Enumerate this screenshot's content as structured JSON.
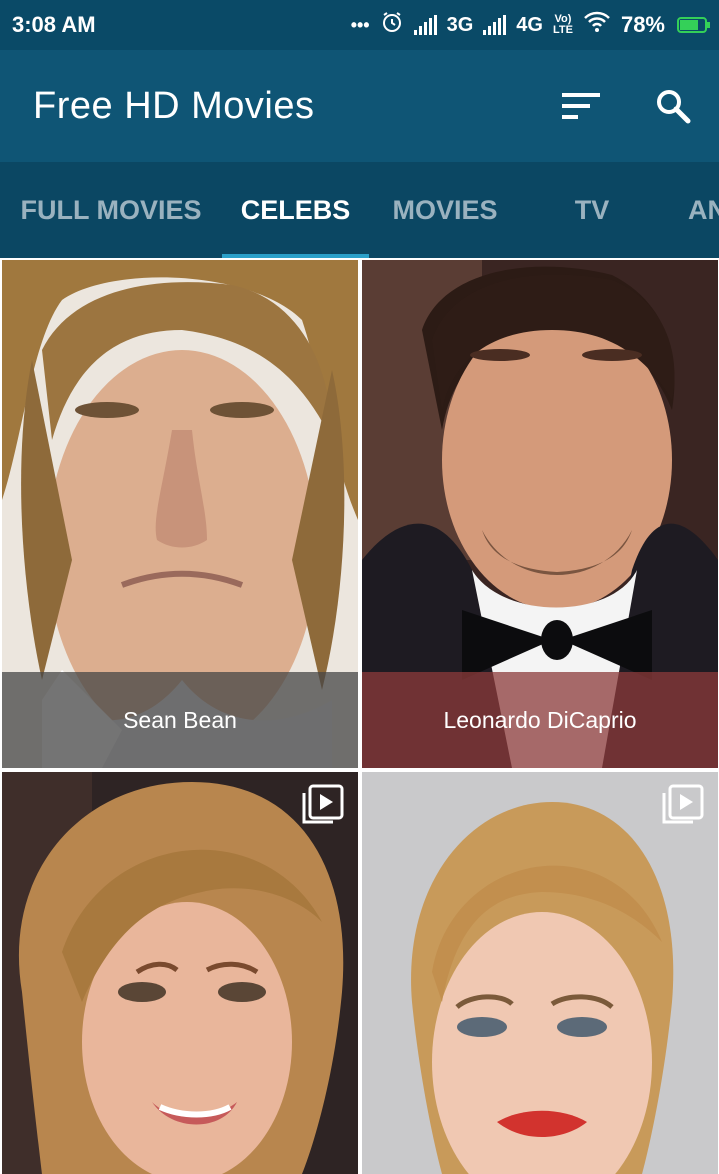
{
  "status_bar": {
    "time": "3:08 AM",
    "dots": "•••",
    "alarm_icon": "alarm-icon",
    "net1": "3G",
    "net2": "4G",
    "volte": "VoLTE",
    "battery": "78%"
  },
  "app_bar": {
    "title": "Free HD Movies",
    "sort_icon": "sort-icon",
    "search_icon": "search-icon"
  },
  "tabs": [
    {
      "label": "FULL MOVIES",
      "active": false
    },
    {
      "label": "CELEBS",
      "active": true
    },
    {
      "label": "MOVIES",
      "active": false
    },
    {
      "label": "TV",
      "active": false
    },
    {
      "label": "AN",
      "active": false
    }
  ],
  "celebs": [
    {
      "name": "Sean Bean",
      "caption_color": "#4a4a4a"
    },
    {
      "name": "Leonardo DiCaprio",
      "caption_color": "#8c3b3b"
    },
    {
      "name": "",
      "icon": "playlist-play-icon"
    },
    {
      "name": "",
      "icon": "playlist-play-icon"
    }
  ],
  "colors": {
    "status_bar": "#0a4a67",
    "app_bar": "#0f5575",
    "tab_bar": "#0b4763",
    "tab_indicator": "#2aa0c9"
  }
}
